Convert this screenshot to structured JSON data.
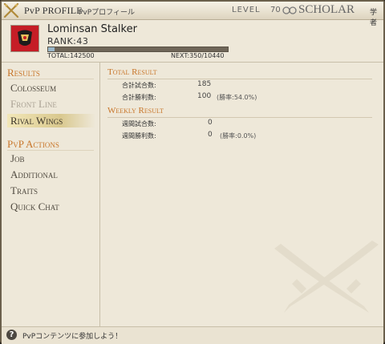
{
  "titlebar": {
    "title": "PvP PROFILE",
    "subtitle": "PvPプロフィール",
    "level_label": "LEVEL",
    "level_value": "70",
    "job_name": "SCHOLAR",
    "job_jp": "学者"
  },
  "profile": {
    "name": "Lominsan Stalker",
    "rank": "RANK:43",
    "total": "TOTAL:142500",
    "next": "NEXT:350/10440",
    "progress_fraction": 0.034
  },
  "sidebar": {
    "results_heading": "Results",
    "results_items": [
      {
        "label": "Colosseum",
        "state": "normal"
      },
      {
        "label": "Front Line",
        "state": "disabled"
      },
      {
        "label": "Rival Wings",
        "state": "selected"
      }
    ],
    "actions_heading": "PvP Actions",
    "actions_items": [
      {
        "label": "Job"
      },
      {
        "label": "Additional"
      },
      {
        "label": "Traits"
      },
      {
        "label": "Quick Chat"
      }
    ]
  },
  "content": {
    "total_heading": "Total Result",
    "total_matches_label": "合計試合数:",
    "total_matches_value": "185",
    "total_wins_label": "合計勝利数:",
    "total_wins_value": "100",
    "total_win_rate": "(勝率:54.0%)",
    "weekly_heading": "Weekly Result",
    "weekly_matches_label": "週間試合数:",
    "weekly_matches_value": "0",
    "weekly_wins_label": "週間勝利数:",
    "weekly_wins_value": "0",
    "weekly_win_rate": "(勝率:0.0%)"
  },
  "footer": {
    "help_icon": "?",
    "message": "PvPコンテンツに参加しよう！"
  },
  "icons": {
    "title": "crossed-swords-icon",
    "job": "scholar-job-icon",
    "watermark": "crossed-swords-watermark-icon",
    "help": "help-icon"
  },
  "colors": {
    "heading_accent": "#c8762a",
    "selected_highlight": "#d9c88e",
    "emblem_red": "#c51d26",
    "progress": "#9ab7c9"
  }
}
